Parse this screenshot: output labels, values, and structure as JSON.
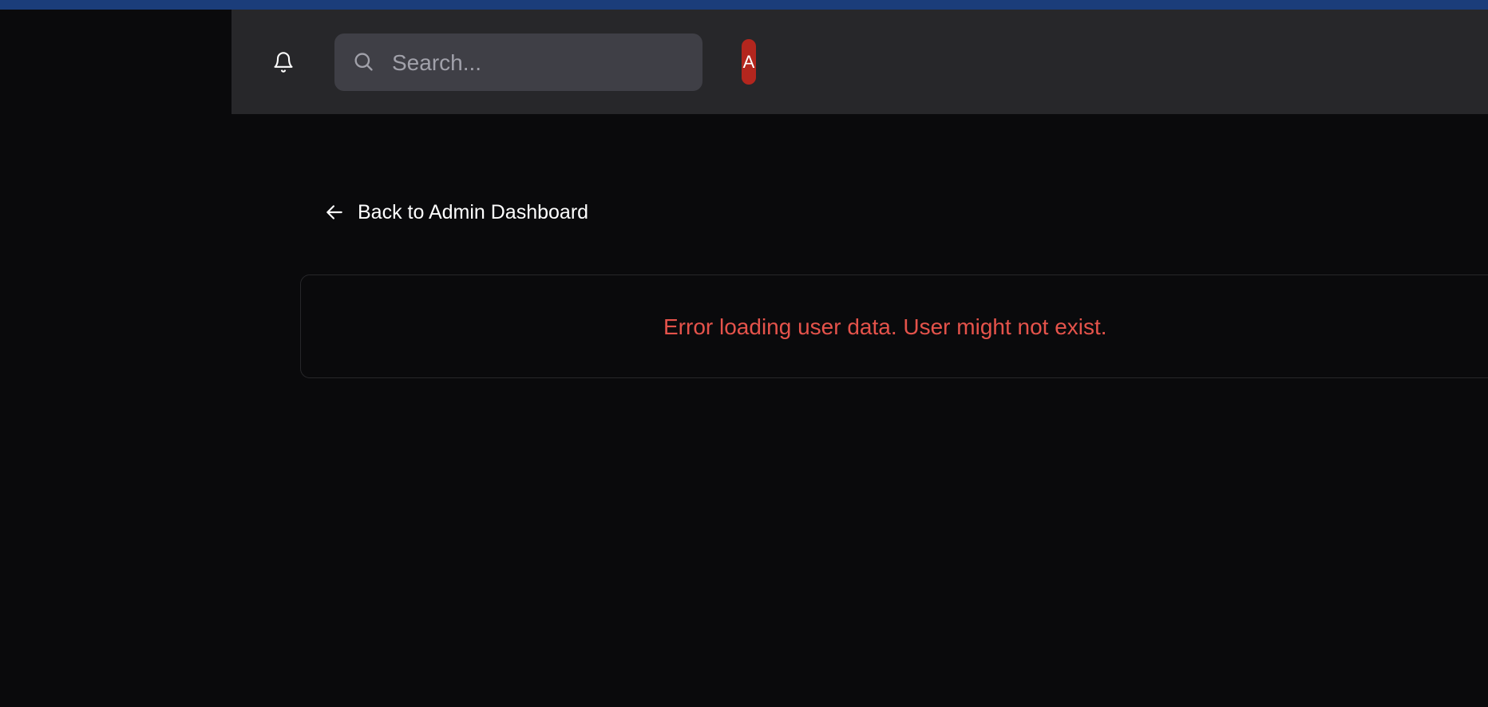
{
  "header": {
    "search": {
      "placeholder": "Search...",
      "value": "",
      "icon": "search-icon"
    },
    "notification_icon": "bell-icon",
    "avatar": {
      "initial": "A",
      "color": "#b3261e"
    }
  },
  "main": {
    "back_link": {
      "label": "Back to Admin Dashboard",
      "icon": "arrow-left-icon"
    },
    "error": {
      "message": "Error loading user data. User might not exist.",
      "color": "#e5534b"
    }
  },
  "colors": {
    "top_strip": "#1b3d7a",
    "header_bg": "#27272a",
    "page_bg": "#0a0a0c",
    "search_bg": "#3f3f46"
  }
}
